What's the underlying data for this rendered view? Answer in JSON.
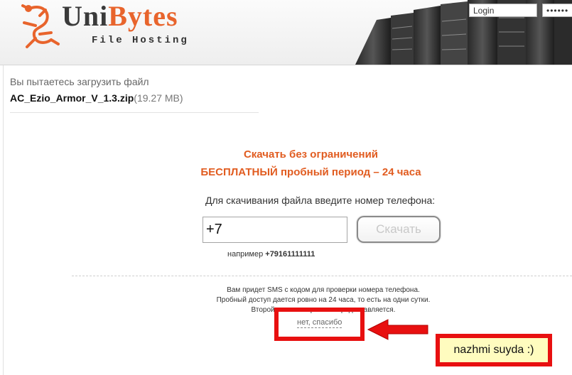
{
  "header": {
    "brand_part1": "Uni",
    "brand_part2": "Bytes",
    "tagline": "File Hosting",
    "login_placeholder": "Login",
    "password_value": "••••••"
  },
  "file": {
    "attempt_text": "Вы пытаетесь загрузить файл",
    "name": "AC_Ezio_Armor_V_1.3.zip",
    "size": "(19.27 MB)"
  },
  "offer": {
    "line1": "Скачать без ограничений",
    "line2": "БЕСПЛАТНЫЙ пробный период – 24 часа"
  },
  "form": {
    "prompt": "Для скачивания файла введите номер телефона:",
    "phone_value": "+7",
    "download_label": "Скачать",
    "example_prefix": "например ",
    "example_number": "+79161111111"
  },
  "info": {
    "line1": "Вам придет SMS с кодом для проверки номера телефона.",
    "line2": "Пробный доступ дается ровно на 24 часа, то есть на одни сутки.",
    "line3": "Второй раз на вторы... не предоставляется."
  },
  "no_thanks": "нет, спасибо",
  "annotation": {
    "note_text": "nazhmi suyda :)"
  },
  "colors": {
    "accent": "#e15c20",
    "annotation_red": "#e81010",
    "note_bg": "#fffcbf"
  }
}
